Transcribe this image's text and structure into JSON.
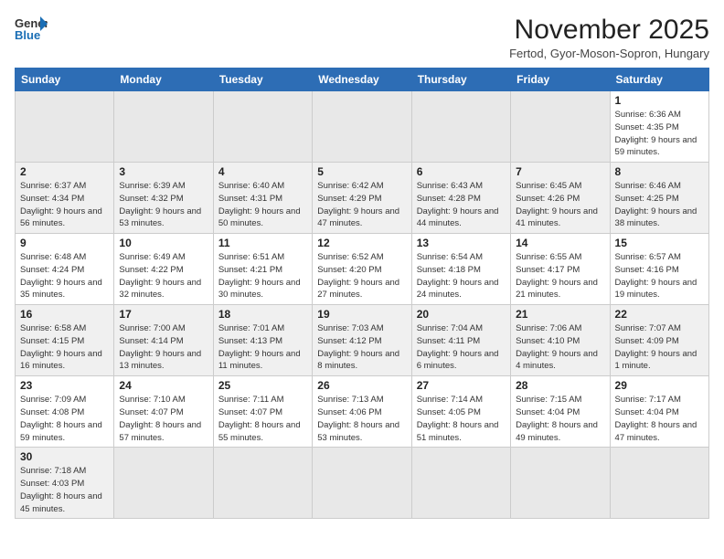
{
  "logo": {
    "text_general": "General",
    "text_blue": "Blue"
  },
  "header": {
    "month_title": "November 2025",
    "subtitle": "Fertod, Gyor-Moson-Sopron, Hungary"
  },
  "weekdays": [
    "Sunday",
    "Monday",
    "Tuesday",
    "Wednesday",
    "Thursday",
    "Friday",
    "Saturday"
  ],
  "weeks": [
    [
      {
        "day": "",
        "empty": true
      },
      {
        "day": "",
        "empty": true
      },
      {
        "day": "",
        "empty": true
      },
      {
        "day": "",
        "empty": true
      },
      {
        "day": "",
        "empty": true
      },
      {
        "day": "",
        "empty": true
      },
      {
        "day": "1",
        "sunrise": "6:36 AM",
        "sunset": "4:35 PM",
        "daylight": "9 hours and 59 minutes."
      }
    ],
    [
      {
        "day": "2",
        "sunrise": "6:37 AM",
        "sunset": "4:34 PM",
        "daylight": "9 hours and 56 minutes."
      },
      {
        "day": "3",
        "sunrise": "6:39 AM",
        "sunset": "4:32 PM",
        "daylight": "9 hours and 53 minutes."
      },
      {
        "day": "4",
        "sunrise": "6:40 AM",
        "sunset": "4:31 PM",
        "daylight": "9 hours and 50 minutes."
      },
      {
        "day": "5",
        "sunrise": "6:42 AM",
        "sunset": "4:29 PM",
        "daylight": "9 hours and 47 minutes."
      },
      {
        "day": "6",
        "sunrise": "6:43 AM",
        "sunset": "4:28 PM",
        "daylight": "9 hours and 44 minutes."
      },
      {
        "day": "7",
        "sunrise": "6:45 AM",
        "sunset": "4:26 PM",
        "daylight": "9 hours and 41 minutes."
      },
      {
        "day": "8",
        "sunrise": "6:46 AM",
        "sunset": "4:25 PM",
        "daylight": "9 hours and 38 minutes."
      }
    ],
    [
      {
        "day": "9",
        "sunrise": "6:48 AM",
        "sunset": "4:24 PM",
        "daylight": "9 hours and 35 minutes."
      },
      {
        "day": "10",
        "sunrise": "6:49 AM",
        "sunset": "4:22 PM",
        "daylight": "9 hours and 32 minutes."
      },
      {
        "day": "11",
        "sunrise": "6:51 AM",
        "sunset": "4:21 PM",
        "daylight": "9 hours and 30 minutes."
      },
      {
        "day": "12",
        "sunrise": "6:52 AM",
        "sunset": "4:20 PM",
        "daylight": "9 hours and 27 minutes."
      },
      {
        "day": "13",
        "sunrise": "6:54 AM",
        "sunset": "4:18 PM",
        "daylight": "9 hours and 24 minutes."
      },
      {
        "day": "14",
        "sunrise": "6:55 AM",
        "sunset": "4:17 PM",
        "daylight": "9 hours and 21 minutes."
      },
      {
        "day": "15",
        "sunrise": "6:57 AM",
        "sunset": "4:16 PM",
        "daylight": "9 hours and 19 minutes."
      }
    ],
    [
      {
        "day": "16",
        "sunrise": "6:58 AM",
        "sunset": "4:15 PM",
        "daylight": "9 hours and 16 minutes."
      },
      {
        "day": "17",
        "sunrise": "7:00 AM",
        "sunset": "4:14 PM",
        "daylight": "9 hours and 13 minutes."
      },
      {
        "day": "18",
        "sunrise": "7:01 AM",
        "sunset": "4:13 PM",
        "daylight": "9 hours and 11 minutes."
      },
      {
        "day": "19",
        "sunrise": "7:03 AM",
        "sunset": "4:12 PM",
        "daylight": "9 hours and 8 minutes."
      },
      {
        "day": "20",
        "sunrise": "7:04 AM",
        "sunset": "4:11 PM",
        "daylight": "9 hours and 6 minutes."
      },
      {
        "day": "21",
        "sunrise": "7:06 AM",
        "sunset": "4:10 PM",
        "daylight": "9 hours and 4 minutes."
      },
      {
        "day": "22",
        "sunrise": "7:07 AM",
        "sunset": "4:09 PM",
        "daylight": "9 hours and 1 minute."
      }
    ],
    [
      {
        "day": "23",
        "sunrise": "7:09 AM",
        "sunset": "4:08 PM",
        "daylight": "8 hours and 59 minutes."
      },
      {
        "day": "24",
        "sunrise": "7:10 AM",
        "sunset": "4:07 PM",
        "daylight": "8 hours and 57 minutes."
      },
      {
        "day": "25",
        "sunrise": "7:11 AM",
        "sunset": "4:07 PM",
        "daylight": "8 hours and 55 minutes."
      },
      {
        "day": "26",
        "sunrise": "7:13 AM",
        "sunset": "4:06 PM",
        "daylight": "8 hours and 53 minutes."
      },
      {
        "day": "27",
        "sunrise": "7:14 AM",
        "sunset": "4:05 PM",
        "daylight": "8 hours and 51 minutes."
      },
      {
        "day": "28",
        "sunrise": "7:15 AM",
        "sunset": "4:04 PM",
        "daylight": "8 hours and 49 minutes."
      },
      {
        "day": "29",
        "sunrise": "7:17 AM",
        "sunset": "4:04 PM",
        "daylight": "8 hours and 47 minutes."
      }
    ],
    [
      {
        "day": "30",
        "sunrise": "7:18 AM",
        "sunset": "4:03 PM",
        "daylight": "8 hours and 45 minutes."
      },
      {
        "day": "",
        "empty": true
      },
      {
        "day": "",
        "empty": true
      },
      {
        "day": "",
        "empty": true
      },
      {
        "day": "",
        "empty": true
      },
      {
        "day": "",
        "empty": true
      },
      {
        "day": "",
        "empty": true
      }
    ]
  ]
}
